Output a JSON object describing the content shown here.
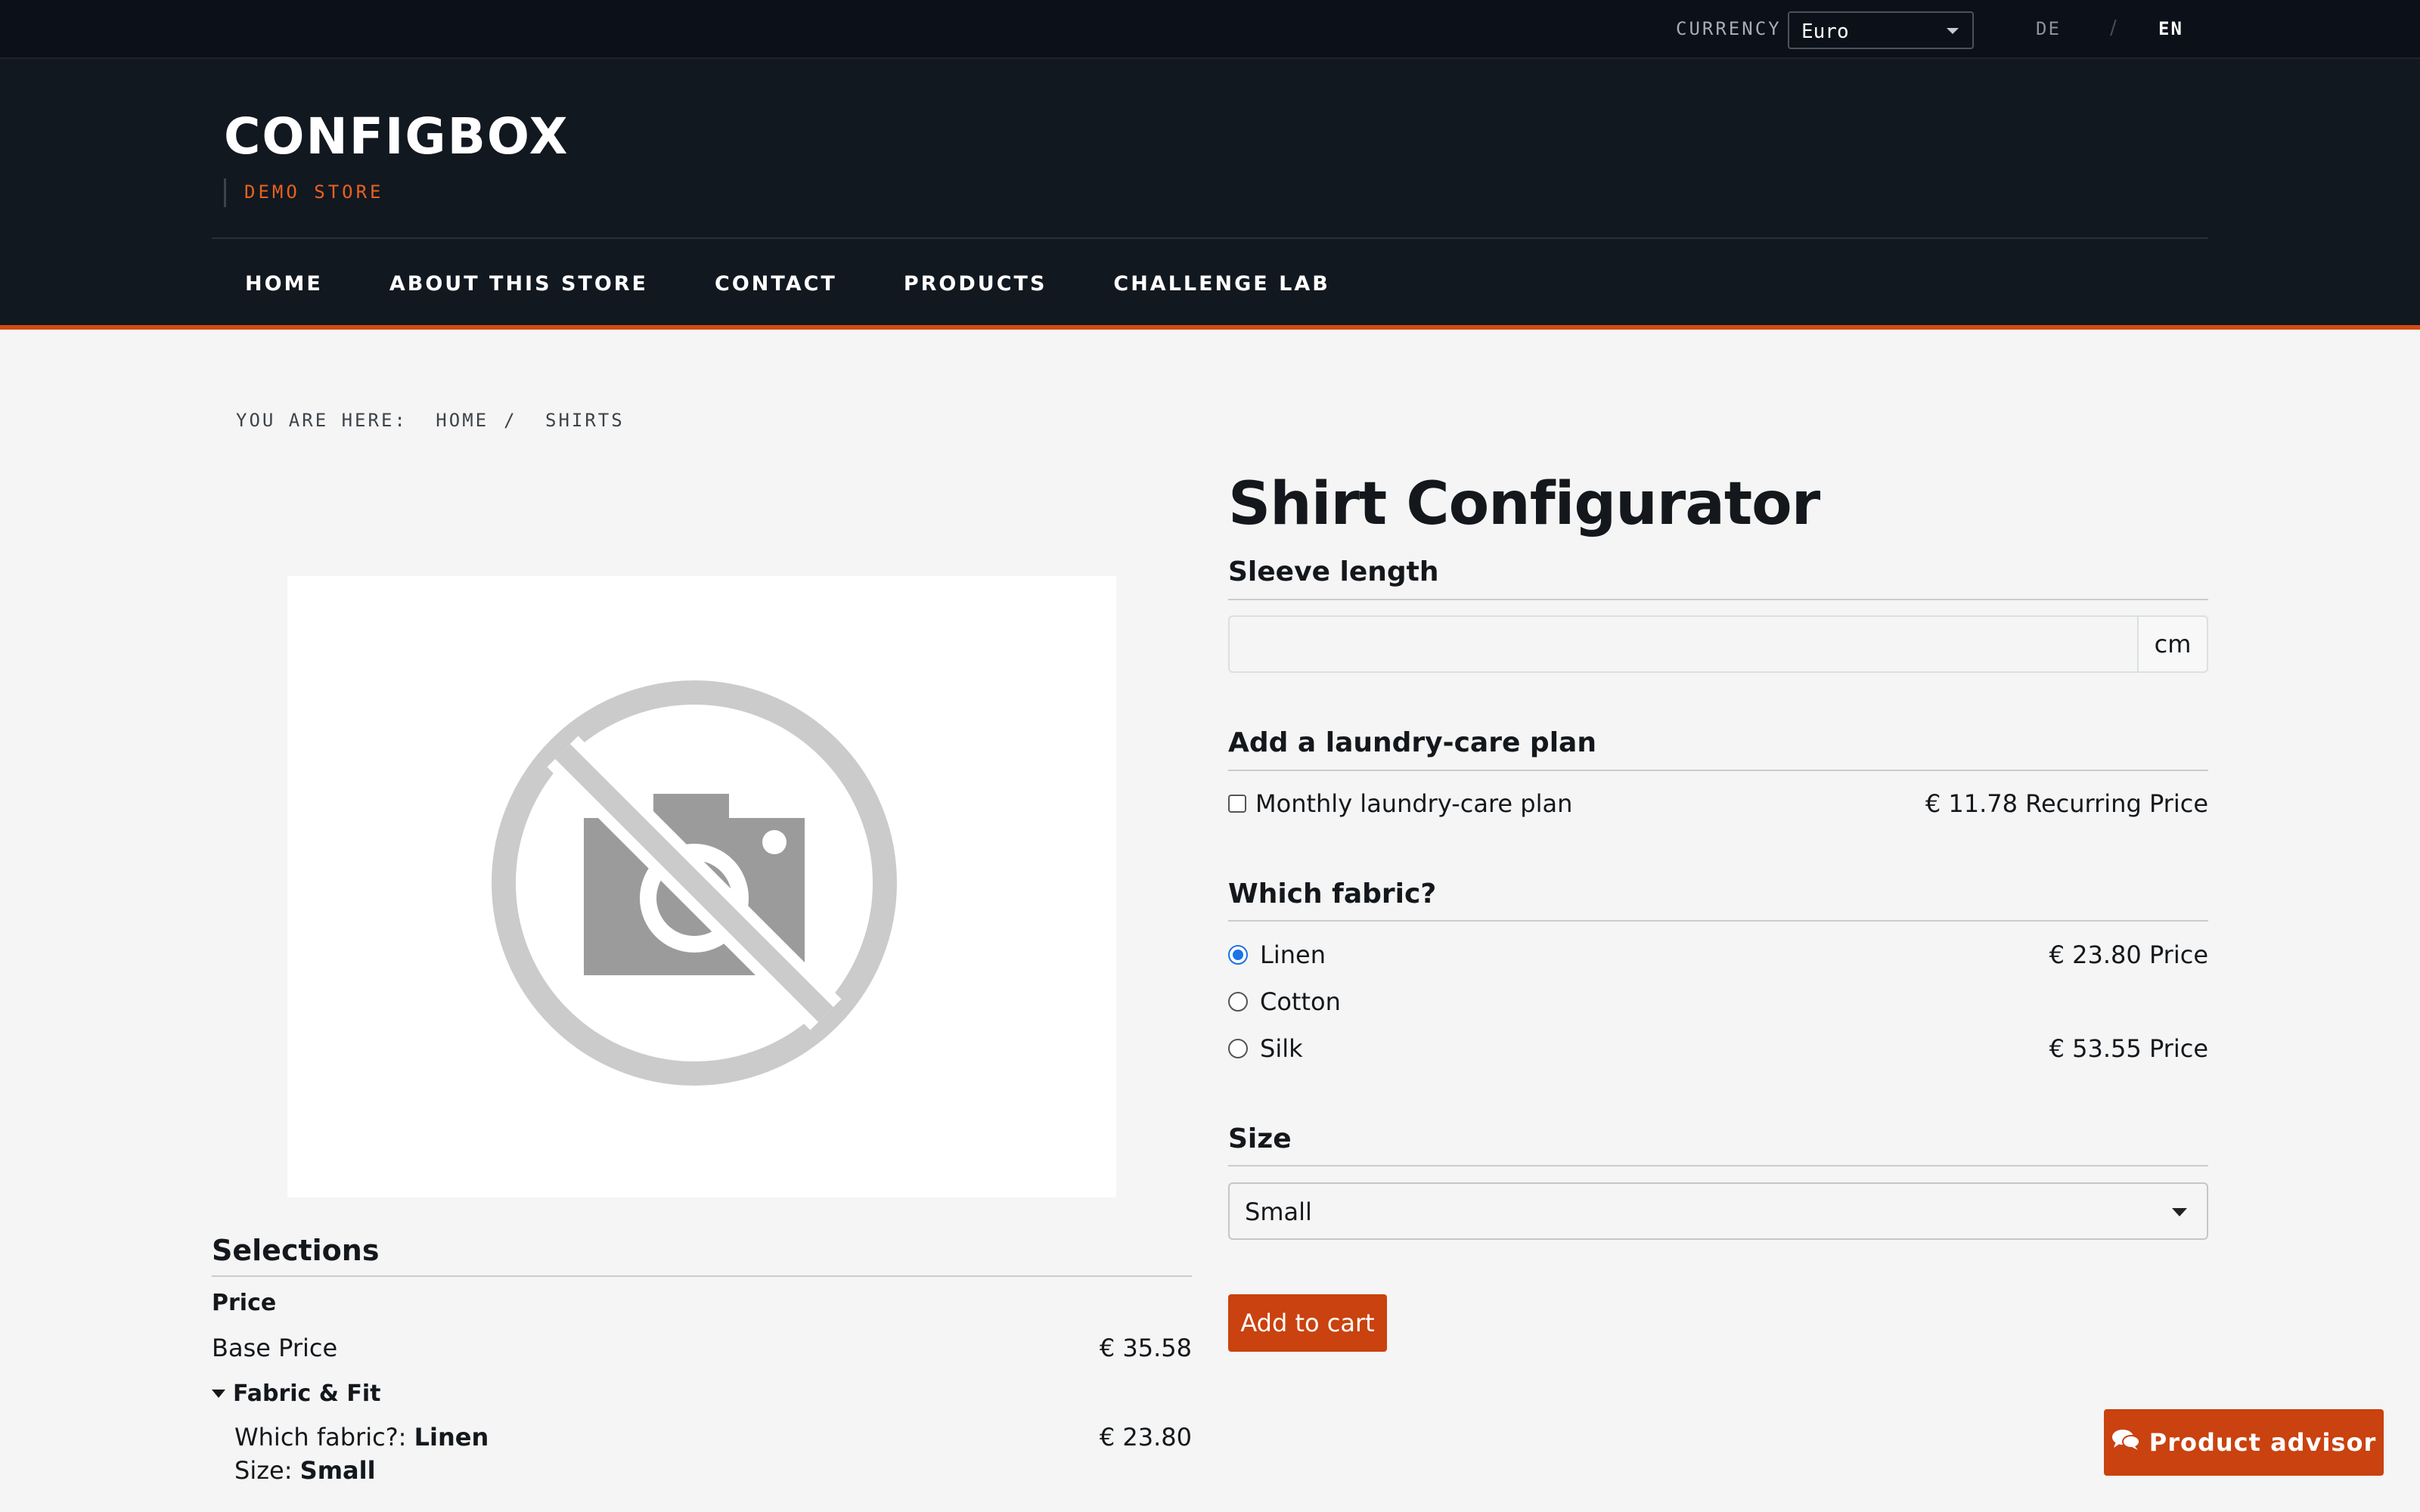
{
  "topbar": {
    "currency_label": "CURRENCY",
    "currency_value": "Euro",
    "lang_de": "DE",
    "lang_sep": "/",
    "lang_en": "EN"
  },
  "header": {
    "brand": "CONFIGBOX",
    "brand_sub": "DEMO STORE",
    "nav": [
      "HOME",
      "ABOUT THIS STORE",
      "CONTACT",
      "PRODUCTS",
      "CHALLENGE LAB"
    ]
  },
  "breadcrumb": {
    "label": "YOU ARE HERE:",
    "items": [
      "HOME",
      "/",
      "SHIRTS"
    ]
  },
  "configurator": {
    "title": "Shirt Configurator",
    "sleeve": {
      "title": "Sleeve length",
      "value": "",
      "unit": "cm"
    },
    "laundry": {
      "title": "Add a laundry-care plan",
      "option_label": "Monthly laundry-care plan",
      "option_price": "€ 11.78 Recurring Price",
      "checked": false
    },
    "fabric": {
      "title": "Which fabric?",
      "options": [
        {
          "label": "Linen",
          "price": "€ 23.80 Price",
          "selected": true
        },
        {
          "label": "Cotton",
          "price": "",
          "selected": false
        },
        {
          "label": "Silk",
          "price": "€ 53.55 Price",
          "selected": false
        }
      ]
    },
    "size": {
      "title": "Size",
      "selected": "Small"
    },
    "add_to_cart": "Add to cart"
  },
  "selections": {
    "title": "Selections",
    "price_heading": "Price",
    "base_price_label": "Base Price",
    "base_price_value": "€ 35.58",
    "group_label": "Fabric & Fit",
    "fabric_label": "Which fabric?:",
    "fabric_value": "Linen",
    "fabric_price": "€ 23.80",
    "size_label": "Size:",
    "size_value": "Small"
  },
  "advisor": {
    "label": "Product advisor"
  },
  "colors": {
    "accent": "#c9420f",
    "header_bg": "#121820",
    "topbar_bg": "#0c1119",
    "brand_sub": "#e8621f"
  }
}
